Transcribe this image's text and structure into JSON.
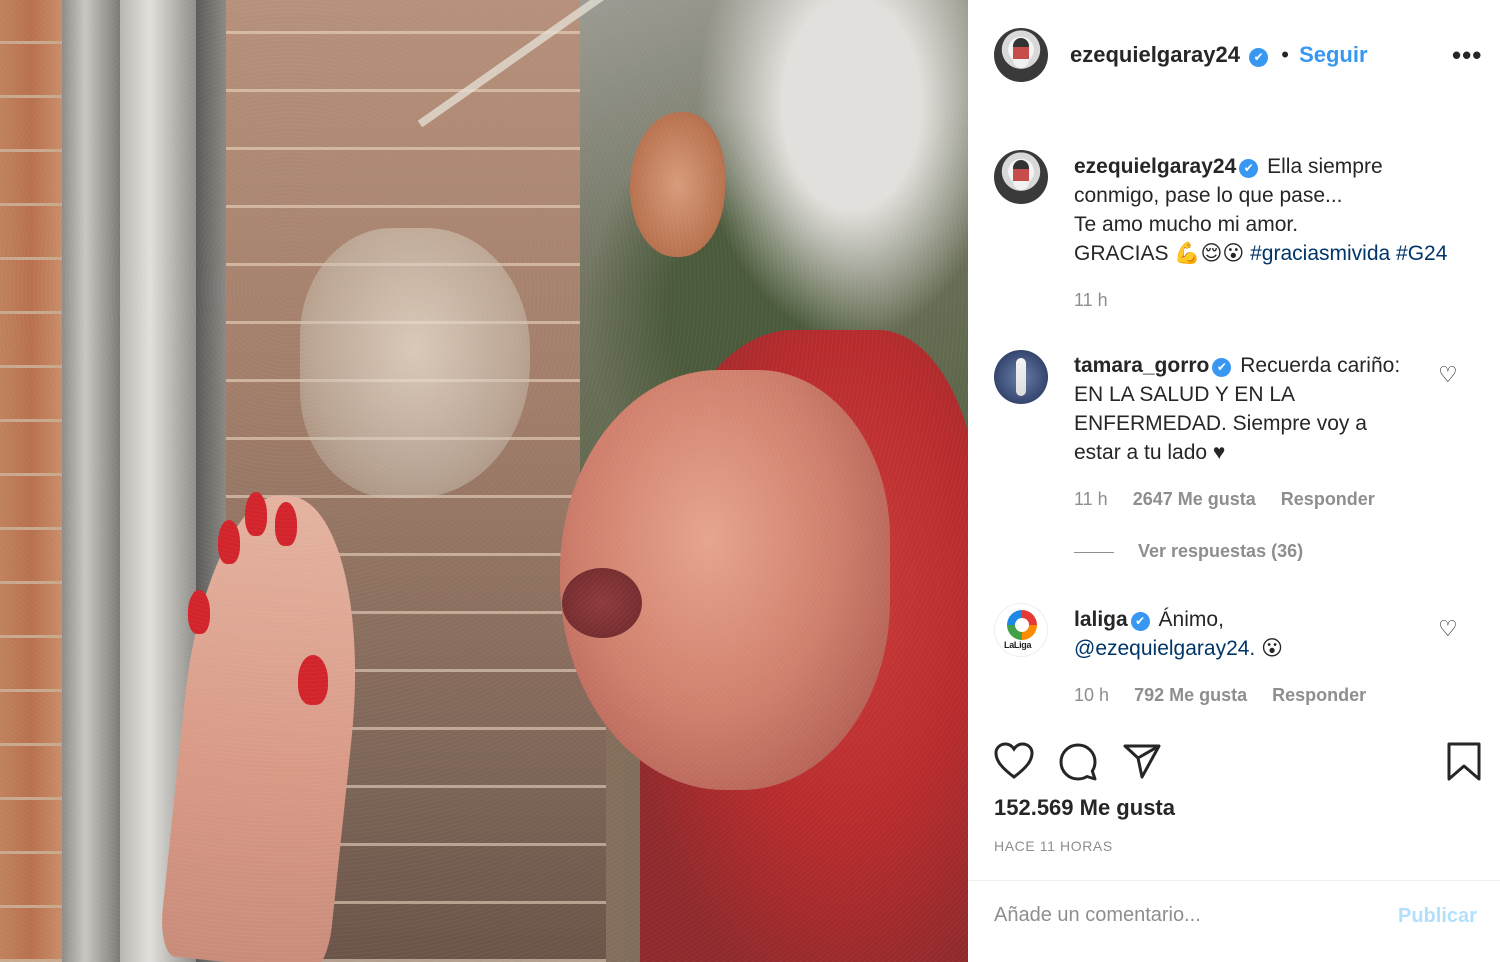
{
  "post": {
    "author": "ezequielgaray24",
    "follow_label": "Seguir",
    "separator": "•",
    "more_label": "•••",
    "verified_icon": "✔",
    "caption": {
      "username": "ezequielgaray24",
      "text_line1": "Ella siempre",
      "text_line2": "conmigo, pase lo que pase...",
      "text_line3": "Te amo mucho mi amor.",
      "text_line4_prefix": "GRACIAS 💪😌😮 ",
      "hashtag1": "#graciasmivida",
      "hashtag2": "#G24",
      "time": "11 h"
    },
    "comments": [
      {
        "username": "tamara_gorro",
        "text_line1": "Recuerda cariño:",
        "text_line2": "EN LA SALUD Y EN LA",
        "text_line3": "ENFERMEDAD. Siempre voy a",
        "text_line4": "estar a tu lado ♥",
        "time": "11 h",
        "likes": "2647 Me gusta",
        "reply": "Responder",
        "view_replies": "Ver respuestas (36)"
      },
      {
        "username": "laliga",
        "avatar_text": "LaLiga",
        "text_line1": "Ánimo,",
        "mention": "@ezequielgaray24.",
        "emoji": " 😮",
        "time": "10 h",
        "likes": "792 Me gusta",
        "reply": "Responder"
      }
    ],
    "likes_total": "152.569 Me gusta",
    "time_ago": "HACE 11 HORAS",
    "add_comment_placeholder": "Añade un comentario...",
    "publish_label": "Publicar"
  },
  "icons": {
    "like": "heart-icon",
    "comment": "comment-icon",
    "share": "share-icon",
    "save": "bookmark-icon",
    "comment_like": "heart-icon"
  },
  "colors": {
    "accent": "#3897f0",
    "link": "#003569",
    "muted": "#8e8e8e",
    "publish": "#b2dffc"
  }
}
